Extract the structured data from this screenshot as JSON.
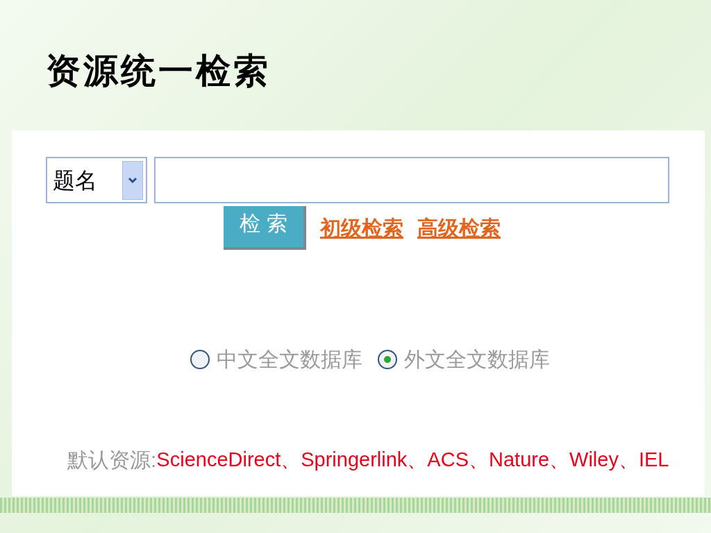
{
  "slide": {
    "title": "资源统一检索"
  },
  "search": {
    "field": "题名",
    "button": "检 索",
    "links": [
      "初级检索",
      "高级检索"
    ]
  },
  "databases": [
    {
      "label": "中文全文数据库",
      "selected": false
    },
    {
      "label": "外文全文数据库",
      "selected": true
    }
  ],
  "default_sources": {
    "label": "默认资源:",
    "value": "ScienceDirect、Springerlink、ACS、Nature、Wiley、IEL"
  }
}
